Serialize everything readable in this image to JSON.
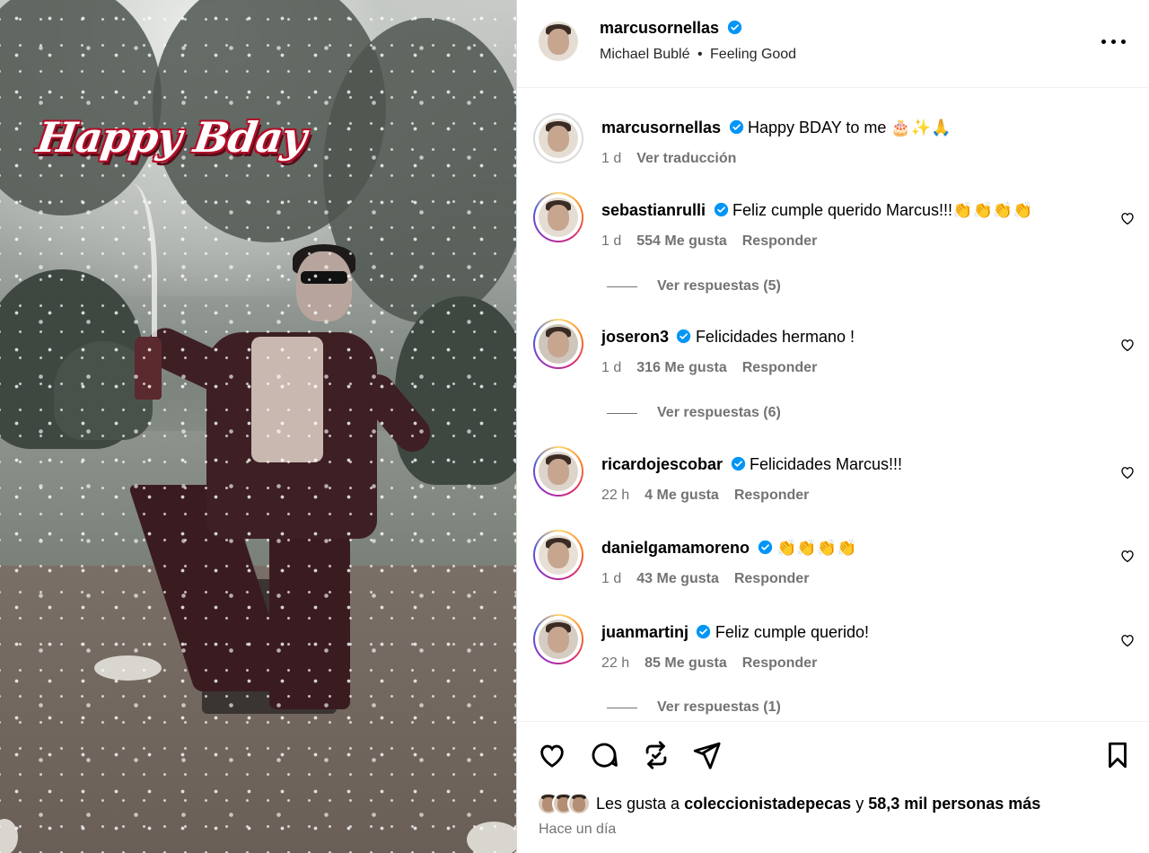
{
  "media": {
    "overlay_text": "Happy Bday"
  },
  "post": {
    "author": "marcusornellas",
    "audio_artist": "Michael Bublé",
    "audio_separator": "•",
    "audio_song": "Feeling Good",
    "caption": "Happy BDAY to me 🎂✨🙏",
    "caption_time": "1 d",
    "translate_label": "Ver traducción"
  },
  "comments": [
    {
      "user": "sebastianrulli",
      "text": "Feliz cumple querido Marcus!!!👏👏👏👏",
      "time": "1 d",
      "likes": "554 Me gusta",
      "reply": "Responder",
      "replies": "Ver respuestas (5)"
    },
    {
      "user": "joseron3",
      "text": "Felicidades hermano !",
      "time": "1 d",
      "likes": "316 Me gusta",
      "reply": "Responder",
      "replies": "Ver respuestas (6)"
    },
    {
      "user": "ricardojescobar",
      "text": "Felicidades Marcus!!!",
      "time": "22 h",
      "likes": "4 Me gusta",
      "reply": "Responder"
    },
    {
      "user": "danielgamamoreno",
      "text": "👏👏👏👏",
      "time": "1 d",
      "likes": "43 Me gusta",
      "reply": "Responder"
    },
    {
      "user": "juanmartinj",
      "text": "Feliz cumple querido!",
      "time": "22 h",
      "likes": "85 Me gusta",
      "reply": "Responder",
      "replies": "Ver respuestas (1)"
    }
  ],
  "footer": {
    "likes_prefix": "Les gusta a",
    "likes_user": "coleccionistadepecas",
    "likes_and": "y",
    "likes_others": "58,3 mil personas más",
    "posted": "Hace un día"
  },
  "icons": {
    "more": "more-horizontal-icon",
    "heart": "heart-icon",
    "comment": "comment-icon",
    "repost": "repost-icon",
    "share": "send-icon",
    "save": "bookmark-icon",
    "verified": "verified-badge-icon"
  },
  "colors": {
    "verified": "#0095f6",
    "muted": "#737373",
    "overlay_red": "#b3102a"
  }
}
